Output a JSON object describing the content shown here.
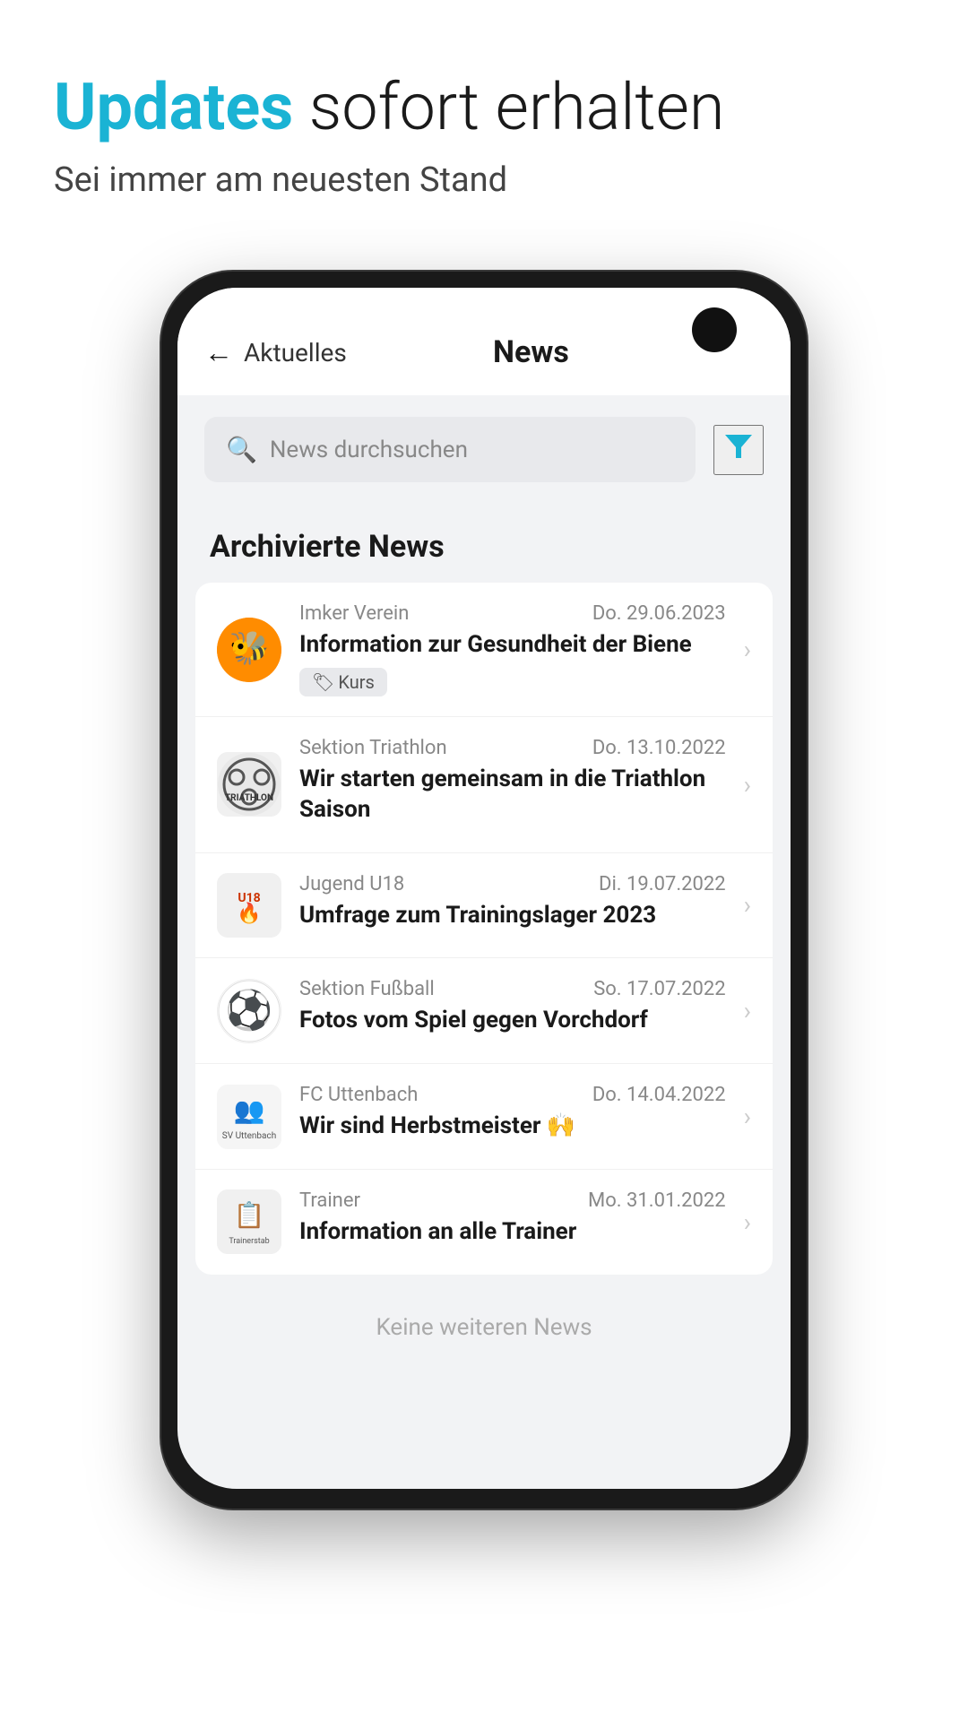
{
  "header": {
    "headline_accent": "Updates",
    "headline_rest": " sofort erhalten",
    "subtitle": "Sei immer am neuesten Stand"
  },
  "phone": {
    "app_back_label": "Aktuelles",
    "app_title": "News",
    "search_placeholder": "News durchsuchen",
    "section_heading": "Archivierte News",
    "filter_icon": "▼",
    "no_more_label": "Keine weiteren News",
    "news_items": [
      {
        "source": "Imker Verein",
        "date": "Do. 29.06.2023",
        "title": "Information zur Gesundheit der Biene",
        "tag": "Kurs",
        "logo_type": "imker"
      },
      {
        "source": "Sektion Triathlon",
        "date": "Do. 13.10.2022",
        "title": "Wir starten gemeinsam in die Triathlon Saison",
        "tag": "",
        "logo_type": "triathlon"
      },
      {
        "source": "Jugend U18",
        "date": "Di. 19.07.2022",
        "title": "Umfrage zum Trainingslager 2023",
        "tag": "",
        "logo_type": "jugend"
      },
      {
        "source": "Sektion Fußball",
        "date": "So. 17.07.2022",
        "title": "Fotos vom Spiel gegen Vorchdorf",
        "tag": "",
        "logo_type": "fussball"
      },
      {
        "source": "FC Uttenbach",
        "date": "Do. 14.04.2022",
        "title": "Wir sind Herbstmeister 🙌",
        "tag": "",
        "logo_type": "uttenbach"
      },
      {
        "source": "Trainer",
        "date": "Mo. 31.01.2022",
        "title": "Information an alle Trainer",
        "tag": "",
        "logo_type": "trainer"
      }
    ]
  }
}
